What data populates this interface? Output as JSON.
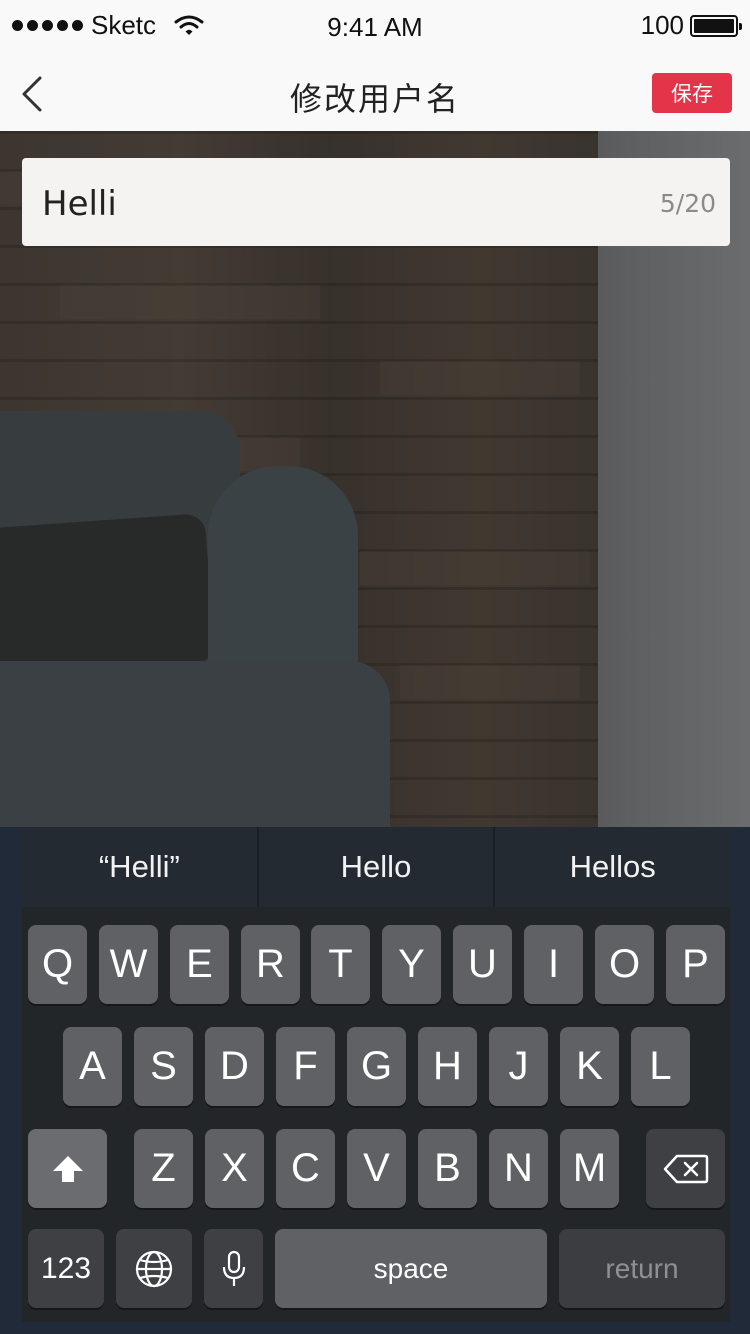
{
  "status_bar": {
    "carrier": "Sketc",
    "time": "9:41 AM",
    "battery": "100",
    "battery_level": 100
  },
  "nav": {
    "title": "修改用户名",
    "save_label": "保存"
  },
  "input": {
    "value": "Helli",
    "counter": "5/20"
  },
  "keyboard": {
    "suggestions": [
      "“Helli”",
      "Hello",
      "Hellos"
    ],
    "row1": [
      "Q",
      "W",
      "E",
      "R",
      "T",
      "Y",
      "U",
      "I",
      "O",
      "P"
    ],
    "row2": [
      "A",
      "S",
      "D",
      "F",
      "G",
      "H",
      "J",
      "K",
      "L"
    ],
    "row3": [
      "Z",
      "X",
      "C",
      "V",
      "B",
      "N",
      "M"
    ],
    "numbers_label": "123",
    "space_label": "space",
    "return_label": "return"
  },
  "icons": {
    "back": "chevron-left-icon",
    "wifi": "wifi-icon",
    "shift": "shift-arrow-icon",
    "delete": "backspace-icon",
    "globe": "globe-icon",
    "mic": "microphone-icon"
  },
  "colors": {
    "accent": "#e3344a",
    "keyboard_bg": "#202a38"
  }
}
